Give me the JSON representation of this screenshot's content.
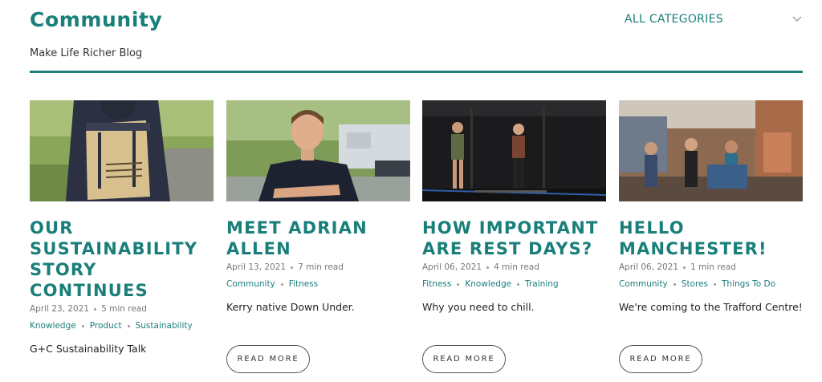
{
  "header": {
    "title": "Community",
    "subtitle": "Make Life Richer Blog",
    "category_select": {
      "value": "ALL CATEGORIES",
      "icon": "chevron-down-icon"
    }
  },
  "colors": {
    "accent": "#1a7f7a",
    "text": "#2b2b2b",
    "muted": "#777777"
  },
  "posts": [
    {
      "title": "OUR SUSTAINABILITY STORY CONTINUES",
      "date": "April 23, 2021",
      "read_time": "5 min read",
      "tags": [
        "Knowledge",
        "Product",
        "Sustainability"
      ],
      "excerpt": "G+C Sustainability Talk"
    },
    {
      "title": "MEET ADRIAN ALLEN",
      "date": "April 13, 2021",
      "read_time": "7 min read",
      "tags": [
        "Community",
        "Fitness"
      ],
      "excerpt": "Kerry native Down Under.",
      "read_more": "READ MORE"
    },
    {
      "title": "HOW IMPORTANT ARE REST DAYS?",
      "date": "April 06, 2021",
      "read_time": "4 min read",
      "tags": [
        "Fitness",
        "Knowledge",
        "Training"
      ],
      "excerpt": "Why you need to chill.",
      "read_more": "READ MORE"
    },
    {
      "title": "HELLO MANCHESTER!",
      "date": "April 06, 2021",
      "read_time": "1 min read",
      "tags": [
        "Community",
        "Stores",
        "Things To Do"
      ],
      "excerpt": "We're coming to the Trafford Centre!",
      "read_more": "READ MORE"
    }
  ]
}
